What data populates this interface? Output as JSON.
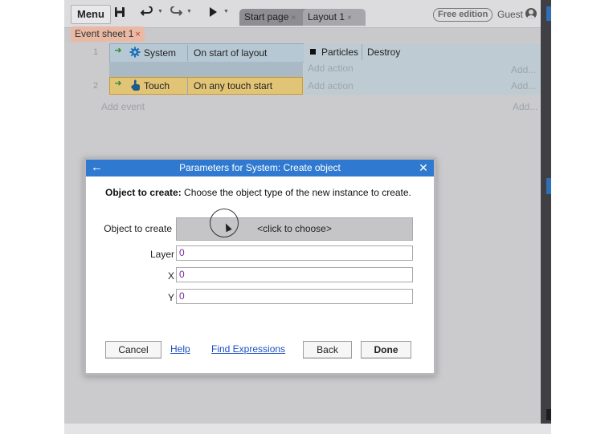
{
  "toolbar": {
    "menu_label": "Menu",
    "tabs": [
      {
        "label": "Start page",
        "close": "×"
      },
      {
        "label": "Layout 1",
        "close": "×"
      }
    ],
    "edition_badge": "Free edition",
    "user_label": "Guest"
  },
  "event_sheet_tab": {
    "label": "Event sheet 1",
    "close": "×"
  },
  "events": [
    {
      "number": "1",
      "condition_object": "System",
      "condition_text": "On start of layout",
      "action_object": "Particles",
      "action_text": "Destroy",
      "add_action": "Add action",
      "add_dots": "Add..."
    },
    {
      "number": "2",
      "condition_object": "Touch",
      "condition_text": "On any touch start",
      "add_action": "Add action",
      "add_dots": "Add..."
    }
  ],
  "add_event": {
    "label": "Add event",
    "dots": "Add..."
  },
  "dialog": {
    "title": "Parameters for System: Create object",
    "description_bold": "Object to create:",
    "description_text": " Choose the object type of the new instance to create.",
    "params": {
      "object_label": "Object to create",
      "object_button": "<click to choose>",
      "layer_label": "Layer",
      "layer_value": "0",
      "x_label": "X",
      "x_value": "0",
      "y_label": "Y",
      "y_value": "0"
    },
    "buttons": {
      "cancel": "Cancel",
      "help": "Help",
      "find_expressions": "Find Expressions",
      "back": "Back",
      "done": "Done"
    }
  },
  "colors": {
    "title_bar": "#2f7ad0",
    "system_condition": "#b6c8d4",
    "touch_condition": "#e2c477",
    "sheet_tab": "#e9b9a5",
    "value_text": "#7a2a9a",
    "link": "#1a4fc4"
  },
  "icons": {
    "save": "save-icon",
    "undo": "undo-icon",
    "redo": "redo-icon",
    "play": "play-icon",
    "user": "user-icon",
    "system": "gear-icon",
    "touch": "hand-icon"
  }
}
